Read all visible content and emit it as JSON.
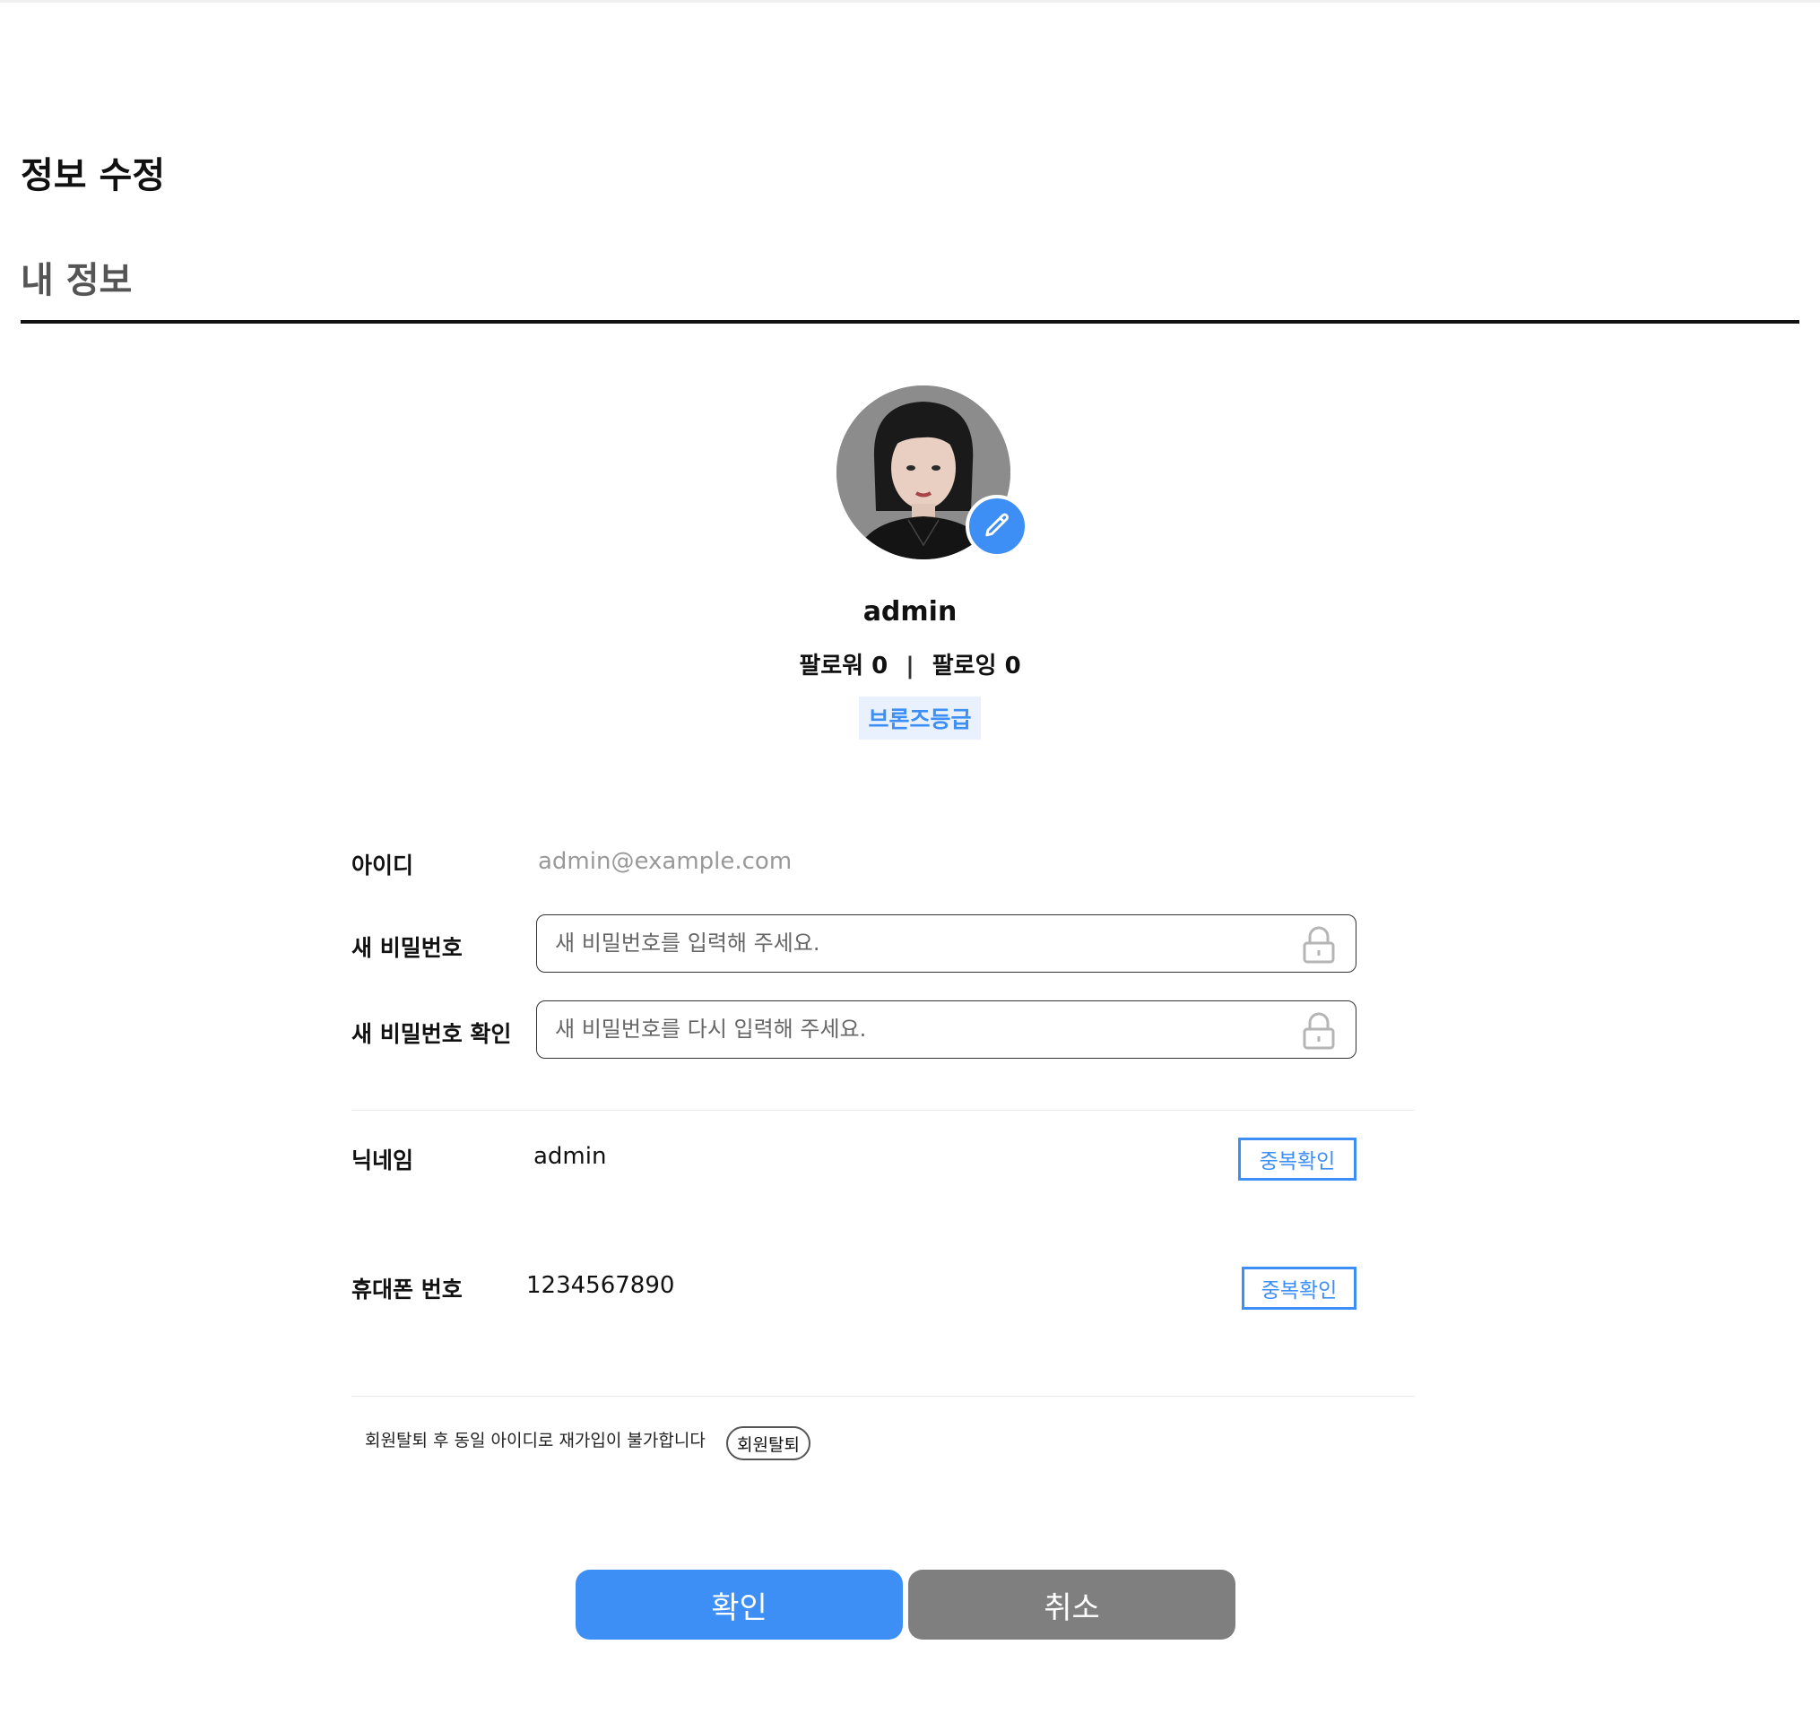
{
  "page": {
    "title": "정보 수정",
    "section_title": "내 정보"
  },
  "profile": {
    "username": "admin",
    "followers_label": "팔로워",
    "followers_count": "0",
    "separator": "|",
    "following_label": "팔로잉",
    "following_count": "0",
    "grade": "브론즈등급"
  },
  "form": {
    "id_label": "아이디",
    "id_value": "admin@example.com",
    "new_password_label": "새 비밀번호",
    "new_password_placeholder": "새 비밀번호를 입력해 주세요.",
    "confirm_password_label": "새 비밀번호 확인",
    "confirm_password_placeholder": "새 비밀번호를 다시 입력해 주세요.",
    "nickname_label": "닉네임",
    "nickname_value": "admin",
    "nickname_check_label": "중복확인",
    "phone_label": "휴대폰 번호",
    "phone_value": "1234567890",
    "phone_check_label": "중복확인"
  },
  "withdraw": {
    "note": "회원탈퇴 후 동일 아이디로 재가입이 불가합니다",
    "button_label": "회원탈퇴"
  },
  "actions": {
    "confirm_label": "확인",
    "cancel_label": "취소"
  },
  "colors": {
    "accent": "#3d8ef5",
    "badge_bg": "#e8f1fd",
    "cancel_bg": "#7f7f7f",
    "heading_muted": "#555555"
  },
  "icons": {
    "edit": "pencil-icon",
    "lock": "lock-icon"
  }
}
